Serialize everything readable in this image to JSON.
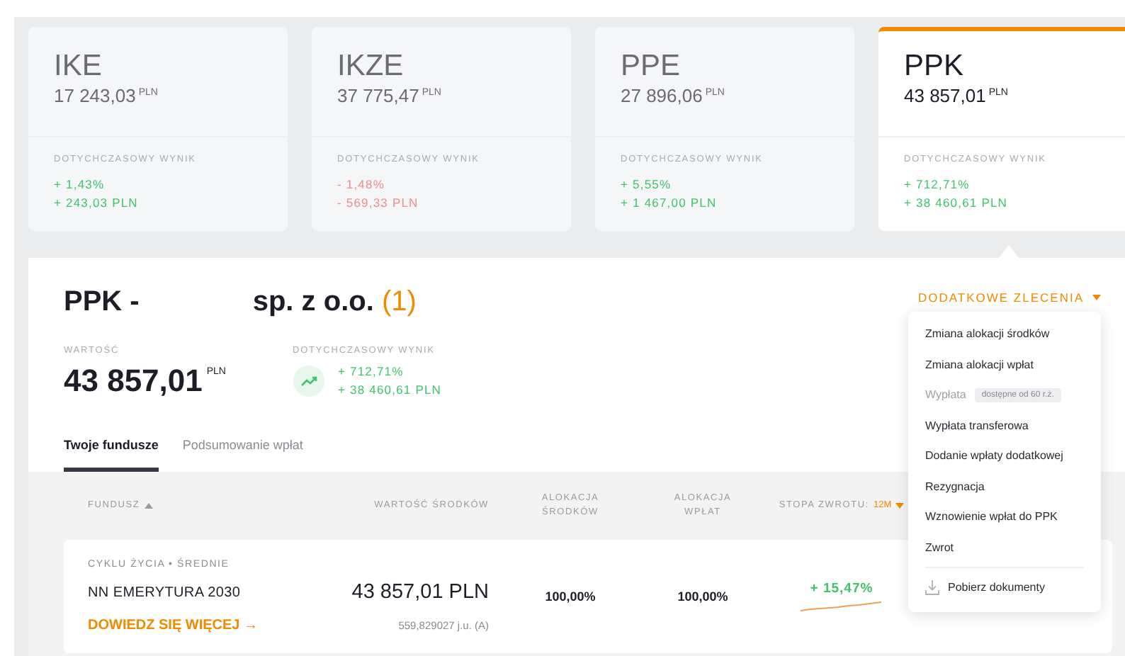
{
  "accounts": [
    {
      "name": "IKE",
      "amount": "17 243,03",
      "currency": "PLN",
      "result_label": "DOTYCHCZASOWY WYNIK",
      "color": "#3fc46b",
      "percent": "+ 1,43%",
      "gain": "+ 243,03 PLN",
      "selected": false
    },
    {
      "name": "IKZE",
      "amount": "37 775,47",
      "currency": "PLN",
      "result_label": "DOTYCHCZASOWY WYNIK",
      "color": "#f08c8c",
      "percent": "- 1,48%",
      "gain": "- 569,33 PLN",
      "selected": false
    },
    {
      "name": "PPE",
      "amount": "27 896,06",
      "currency": "PLN",
      "result_label": "DOTYCHCZASOWY WYNIK",
      "color": "#3fc46b",
      "percent": "+ 5,55%",
      "gain": "+ 1 467,00 PLN",
      "selected": false
    },
    {
      "name": "PPK",
      "amount": "43 857,01",
      "currency": "PLN",
      "result_label": "DOTYCHCZASOWY WYNIK",
      "color": "#3fc46b",
      "percent": "+ 712,71%",
      "gain": "+ 38 460,61 PLN",
      "selected": true
    }
  ],
  "detail": {
    "title_prefix": "PPK -",
    "title_suffix": "sp. z o.o.",
    "count": "(1)",
    "value_label": "WARTOŚĆ",
    "value": "43 857,01",
    "currency": "PLN",
    "result_label": "DOTYCHCZASOWY WYNIK",
    "color": "#3fc46b",
    "percent": "+ 712,71%",
    "gain": "+ 38 460,61 PLN"
  },
  "orders_button": {
    "label": "DODATKOWE ZLECENIA",
    "expanded": true
  },
  "orders_menu": [
    {
      "kind": "action",
      "label": "Zmiana alokacji środków",
      "disabled": false
    },
    {
      "kind": "action",
      "label": "Zmiana alokacji wpłat",
      "disabled": false
    },
    {
      "kind": "action",
      "label": "Wypłata",
      "disabled": true,
      "note": "dostępne od 60 r.ż."
    },
    {
      "kind": "action",
      "label": "Wypłata transferowa",
      "disabled": false
    },
    {
      "kind": "action",
      "label": "Dodanie wpłaty dodatkowej",
      "disabled": false
    },
    {
      "kind": "action",
      "label": "Rezygnacja",
      "disabled": false
    },
    {
      "kind": "action",
      "label": "Wznowienie wpłat do PPK",
      "disabled": false
    },
    {
      "kind": "action",
      "label": "Zwrot",
      "disabled": false
    },
    {
      "kind": "download",
      "label": "Pobierz dokumenty",
      "disabled": false
    }
  ],
  "tabs": [
    {
      "label": "Twoje fundusze",
      "selected": true
    },
    {
      "label": "Podsumowanie wpłat",
      "selected": false
    }
  ],
  "table": {
    "columns": [
      {
        "label": "FUNDUSZ",
        "sorted": true
      },
      {
        "label": "WARTOŚĆ ŚRODKÓW",
        "sorted": false
      },
      {
        "label": "ALOKACJA ŚRODKÓW",
        "sorted": false
      },
      {
        "label": "ALOKACJA WPŁAT",
        "sorted": false
      },
      {
        "label": "STOPA ZWROTU:",
        "sorted": false,
        "period": "12M"
      }
    ],
    "rows": [
      {
        "category": "CYKLU ŻYCIA • ŚREDNIE",
        "name": "NN EMERYTURA 2030",
        "link": "DOWIEDZ SIĘ WIĘCEJ →",
        "value": "43 857,01 PLN",
        "units": "559,829027 j.u. (A)",
        "allocation_funds": "100,00%",
        "allocation_payments": "100,00%",
        "color": "#3fc46b",
        "return": "+ 15,47%"
      }
    ]
  }
}
